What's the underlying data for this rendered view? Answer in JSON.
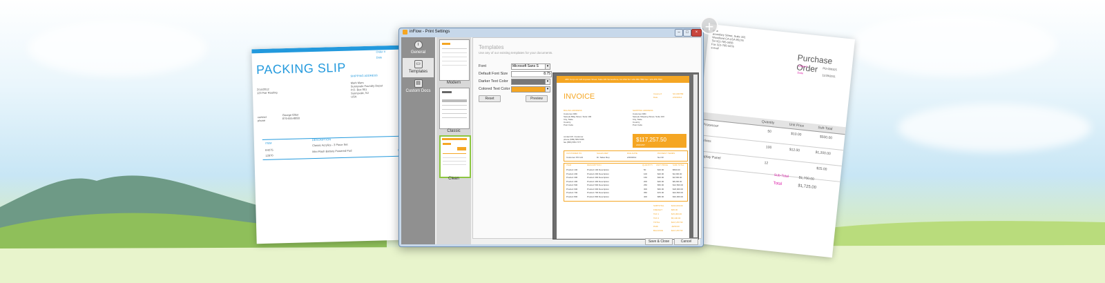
{
  "packing_slip": {
    "title": "PACKING SLIP",
    "order_label": "Order #",
    "date_label": "Date",
    "shipping_heading": "SHIPPING ADDRESS",
    "date_value": "2/14/2012",
    "sub_line": "123 Fair Routing",
    "addr_lines": [
      "Mark Mars",
      "Sunnyvale Foundry Depot",
      "P.O. Box 951",
      "Sunnyvale, NJ",
      "USA"
    ],
    "contact_label": "contact",
    "contact_value": "George Elliot",
    "phone_label": "phone",
    "phone_value": "879-555-8893",
    "col_item": "ITEM",
    "col_desc": "DESCRIPTION",
    "rows": [
      {
        "item": "E4275",
        "desc": "Classic Acrylics - 3 Piece Set"
      },
      {
        "item": "12870",
        "desc": "Mini Flash Battery Powered Pod"
      }
    ],
    "notes": "NOTE"
  },
  "purchase_order": {
    "title": "Purchase Order",
    "order_label": "Order #",
    "order_value": "PO-000325",
    "date_label": "Date",
    "date_value": "11/29/2011",
    "vendor_lines": [
      "ome",
      "Boundary Street, Suite 101",
      "Woodland CA  USA 95176",
      "Tel    321-785-3456",
      "Fax    321-785-3476",
      "e-mail"
    ],
    "col_qty": "Quantity",
    "col_unit": "Unit Price",
    "col_sub": "Sub-Total",
    "rows": [
      {
        "name": "Processor",
        "qty": "50",
        "price": "$10.00",
        "sub": "$500.00"
      },
      {
        "name": "Drives",
        "qty": "100",
        "price": "$12.00",
        "sub": "$1,200.00"
      },
      {
        "name": "Display Panel",
        "qty": "12",
        "price": "",
        "sub": "$25.00"
      }
    ],
    "subtotal_label": "Sub-Total",
    "subtotal_value": "$1,700.00",
    "total_label": "Total",
    "total_value": "$1,725.00"
  },
  "window": {
    "title": "inFlow - Print Settings",
    "minimize": "–",
    "maximize": "□",
    "close": "×"
  },
  "sidebar": {
    "items": [
      {
        "label": "General",
        "icon": "i"
      },
      {
        "label": "Templates",
        "icon": "▭"
      },
      {
        "label": "Custom Docs",
        "icon": "▤"
      }
    ]
  },
  "templates": {
    "items": [
      {
        "label": "Modern"
      },
      {
        "label": "Classic"
      },
      {
        "label": "Clean"
      }
    ]
  },
  "settings": {
    "title": "Templates",
    "subtitle": "Use any of our existing templates for your documents.",
    "font_label": "Font",
    "font_value": "Microsoft Sans S",
    "font_size_label": "Default Font Size",
    "font_size_value": "8.75",
    "darker_label": "Darker Text Color",
    "colored_label": "Colored Text Color",
    "reset_button": "Reset",
    "preview_button": "Preview"
  },
  "invoice": {
    "header_bar": "ABC Corp Ltd.    123 Anytown Street, Suite 101    Somewhere, CA USA    Tel: 123-456-7890    Fax: 123-456-7891",
    "title": "INVOICE",
    "invoice_label": "Invoice #",
    "invoice_value": "SO-000789",
    "date_label": "Date",
    "date_value": "2/20/2012",
    "billing_heading": "BILLING ADDRESS",
    "billing_lines": [
      "Customer ABC",
      "Sample Bldg Street, Suite 100",
      "City, State",
      "Country",
      "Post Code"
    ],
    "shipping_heading": "SHIPPING ADDRESS",
    "shipping_lines": [
      "Customer ABC",
      "Sample Shipping Street, Suite 100",
      "City, State",
      "Country",
      "Post Code"
    ],
    "contact_lines": [
      "contact    Mr. Customer",
      "phone      (555) 555-5785",
      "fax           (555) 555-7777"
    ],
    "total_amount": "$117,257.50",
    "total_label": "AMOUNT",
    "info_headers": [
      "CUSTOMER PO",
      "SALES REP",
      "DUE DATE",
      "PAYMENT TERMS"
    ],
    "info_values": [
      "Customer PO 123",
      "Dr. Sales Rep",
      "2/20/2012",
      "Net 30"
    ],
    "line_headers": [
      "ITEM",
      "DESCRIPTION",
      "QUANTITY",
      "UNIT PRICE",
      "SUB-TOTAL"
    ],
    "lines": [
      [
        "Product 100",
        "Product 100 Description",
        "50",
        "$10.00",
        "$500.00"
      ],
      [
        "Product 200",
        "Product 200 Description",
        "100",
        "$20.00",
        "$2,000.00"
      ],
      [
        "Product 300",
        "Product 300 Description",
        "150",
        "$30.00",
        "$4,500.00"
      ],
      [
        "Product 400",
        "Product 400 Description",
        "200",
        "$40.00",
        "$8,000.00"
      ],
      [
        "Product 500",
        "Product 500 Description",
        "250",
        "$50.00",
        "$12,500.00"
      ],
      [
        "Product 600",
        "Product 600 Description",
        "300",
        "$60.00",
        "$18,000.00"
      ],
      [
        "Product 700",
        "Product 700 Description",
        "350",
        "$70.00",
        "$24,500.00"
      ],
      [
        "Product 800",
        "Product 800 Description",
        "400",
        "$80.00",
        "$32,000.00"
      ]
    ],
    "totals": [
      {
        "label": "SUBTOTAL",
        "value": "$102,000.00"
      },
      {
        "label": "FREIGHT",
        "value": "$95.00"
      },
      {
        "label": "TAX 1",
        "value": "$15,300.00"
      },
      {
        "label": "TAX 2",
        "value": "$5,100.00"
      },
      {
        "label": "TOTAL",
        "value": "$117,257.50"
      },
      {
        "label": "PAID",
        "value": "-$150.00"
      },
      {
        "label": "BALANCE",
        "value": "$117,257.50"
      }
    ]
  },
  "footer": {
    "save_close": "Save & Close",
    "cancel": "Cancel"
  },
  "add_icon": "+",
  "colors": {
    "accent_orange": "#f5a623",
    "packing_blue": "#2299dd",
    "po_pink": "#dd22aa",
    "darker_text_swatch": "#777777",
    "colored_text_swatch": "#f5a623"
  }
}
